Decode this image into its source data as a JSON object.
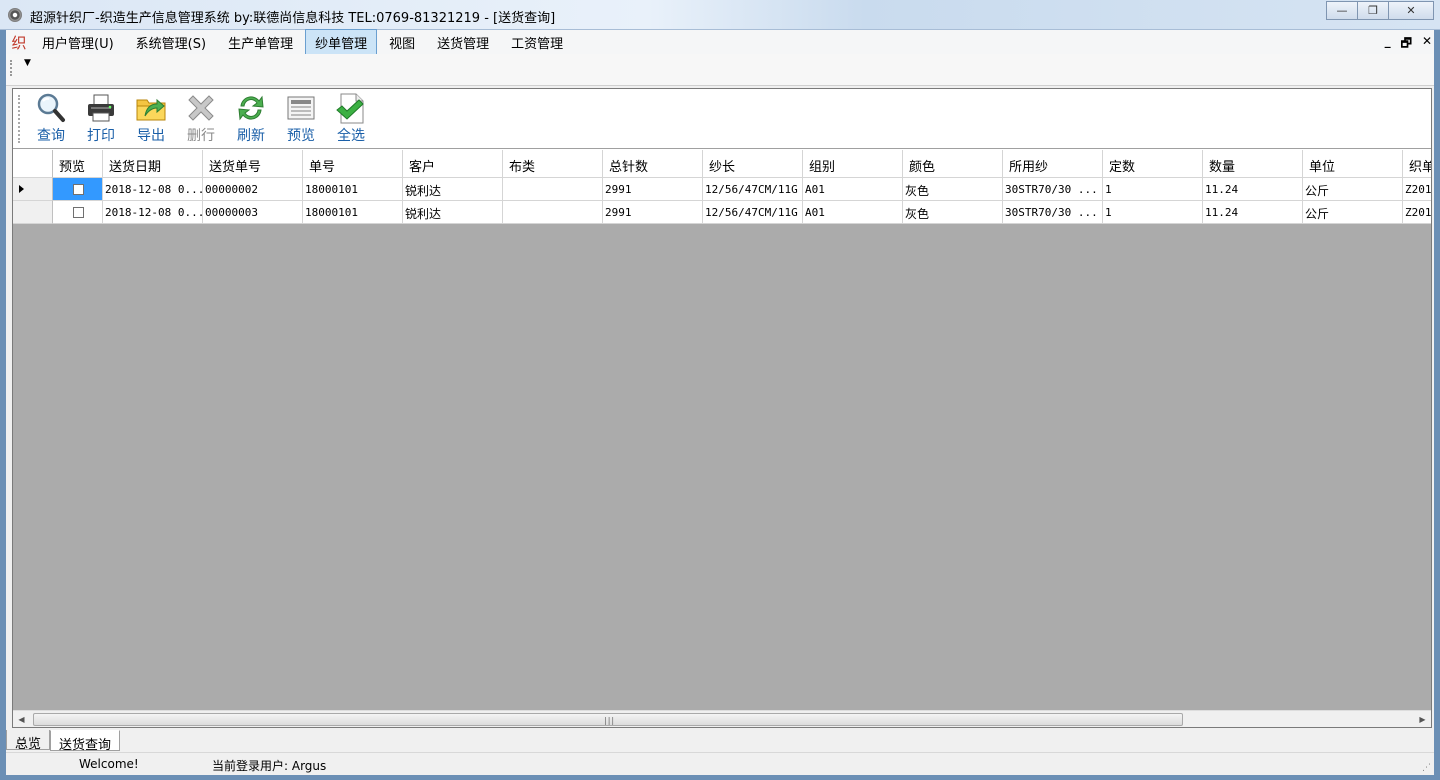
{
  "window": {
    "title": "超源针织厂-织造生产信息管理系统   by:联德尚信息科技   TEL:0769-81321219 - [送货查询]",
    "min_label": "—",
    "max_label": "❐",
    "close_label": "✕"
  },
  "menu": {
    "logo": "织",
    "items": [
      "用户管理(U)",
      "系统管理(S)",
      "生产单管理",
      "纱单管理",
      "视图",
      "送货管理",
      "工资管理"
    ],
    "active_index": 3,
    "mdi_min": "_",
    "mdi_restore": "🗗",
    "mdi_close": "✕"
  },
  "toolbar": {
    "buttons": [
      {
        "label": "查询",
        "icon": "search-icon",
        "enabled": true
      },
      {
        "label": "打印",
        "icon": "printer-icon",
        "enabled": true
      },
      {
        "label": "导出",
        "icon": "export-folder-icon",
        "enabled": true
      },
      {
        "label": "删行",
        "icon": "delete-x-icon",
        "enabled": false
      },
      {
        "label": "刷新",
        "icon": "refresh-icon",
        "enabled": true
      },
      {
        "label": "预览",
        "icon": "preview-icon",
        "enabled": true
      },
      {
        "label": "全选",
        "icon": "select-all-check-icon",
        "enabled": true
      }
    ]
  },
  "grid": {
    "columns": [
      "预览",
      "送货日期",
      "送货单号",
      "单号",
      "客户",
      "布类",
      "总针数",
      "纱长",
      "组别",
      "颜色",
      "所用纱",
      "定数",
      "数量",
      "单位",
      "织单"
    ],
    "rows": [
      {
        "date": "2018-12-08 0...",
        "delivery_no": "00000002",
        "order_no": "18000101",
        "customer": "锐利达",
        "fabric": "",
        "needles": "2991",
        "yarn_len": "12/56/47CM/11G",
        "group": "A01",
        "color": "灰色",
        "yarn": "30STR70/30 ...",
        "fixed": "1",
        "qty": "11.24",
        "unit": "公斤",
        "weave": "Z201"
      },
      {
        "date": "2018-12-08 0...",
        "delivery_no": "00000003",
        "order_no": "18000101",
        "customer": "锐利达",
        "fabric": "",
        "needles": "2991",
        "yarn_len": "12/56/47CM/11G",
        "group": "A01",
        "color": "灰色",
        "yarn": "30STR70/30 ...",
        "fixed": "1",
        "qty": "11.24",
        "unit": "公斤",
        "weave": "Z201"
      }
    ]
  },
  "tabs": [
    "总览",
    "送货查询"
  ],
  "active_tab": 1,
  "status": {
    "welcome": "Welcome!",
    "user": "当前登录用户: Argus"
  }
}
